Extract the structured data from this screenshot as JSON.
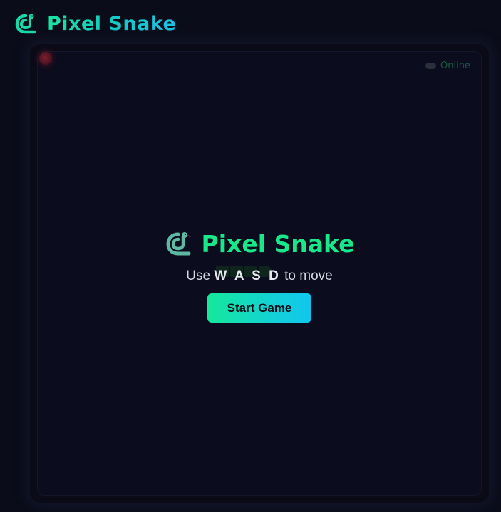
{
  "header": {
    "title": "Pixel Snake",
    "logo_icon": "snake-icon"
  },
  "board": {
    "status_label": "Online",
    "food_icon": "apple-icon"
  },
  "overlay": {
    "title": "Pixel Snake",
    "logo_icon": "snake-icon",
    "instructions_prefix": "Use ",
    "instructions_keys": "W A S D",
    "instructions_suffix": " to move",
    "start_button_label": "Start Game"
  },
  "colors": {
    "background": "#0b0c1a",
    "accent_green": "#19e88a",
    "accent_cyan": "#10c6ee",
    "food_red": "#7a1e2c"
  }
}
